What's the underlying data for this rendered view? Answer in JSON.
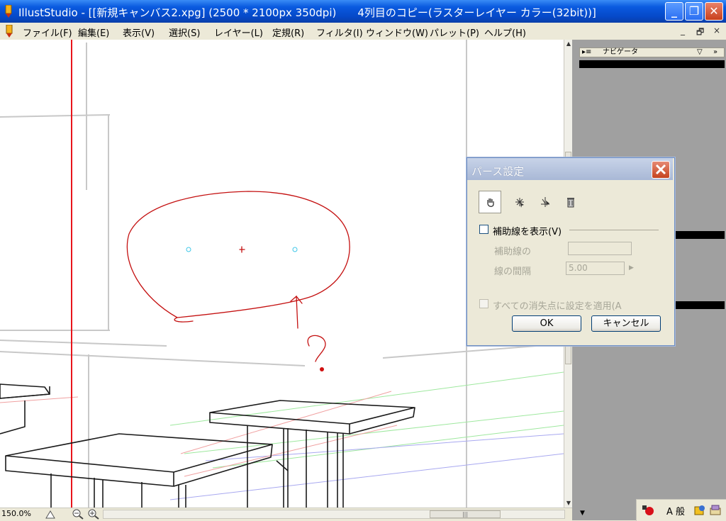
{
  "window": {
    "title": "IllustStudio - [[新規キャンバス2.xpg] (2500 * 2100px 350dpi)　　4列目のコピー(ラスターレイヤー カラー(32bit))]",
    "app_icon": "pencil-icon",
    "controls": {
      "minimize": "minimize-icon",
      "restore": "restore-icon",
      "close": "close-icon"
    }
  },
  "menu": {
    "items": [
      "ファイル(F)",
      "編集(E)",
      "表示(V)",
      "選択(S)",
      "レイヤー(L)",
      "定規(R)",
      "フィルタ(I)",
      "ウィンドウ(W)",
      "パレット(P)",
      "ヘルプ(H)"
    ],
    "mdi_controls": [
      "_",
      "🗗",
      "×"
    ]
  },
  "status": {
    "zoom": "150.0%"
  },
  "navigator": {
    "title": "ナビゲータ",
    "menu_glyph": "▽",
    "expand_glyph": "»",
    "grip": "▸≡"
  },
  "dialog": {
    "title": "パース設定",
    "tools": [
      "hand-icon",
      "add-vanishing-point-icon",
      "move-vanishing-point-icon",
      "delete-icon"
    ],
    "show_guides_label": "補助線を表示(V)",
    "guide_color_label": "補助線の",
    "line_spacing_label": "線の間隔",
    "line_spacing_value": "5.00",
    "apply_all_label": "すべての消失点に設定を適用(A",
    "ok_label": "OK",
    "cancel_label": "キャンセル"
  },
  "tray": {
    "ime_text": "A 般"
  },
  "colors": {
    "guide_red": "#e8141a",
    "sketch_red": "#c41010",
    "vanishing_cyan": "#3fc7e8",
    "titlebar_blue": "#0a5ae0"
  }
}
